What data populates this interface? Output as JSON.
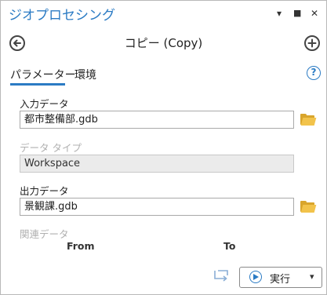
{
  "pane": {
    "title": "ジオプロセシング",
    "controls": {
      "dropdown": "▾",
      "maximize": "■",
      "close": "✕"
    }
  },
  "nav": {
    "back_icon": "back-arrow-icon",
    "tool_title": "コピー (Copy)",
    "add_icon": "add-icon"
  },
  "tabs": [
    {
      "label": "パラメーター",
      "active": true
    },
    {
      "label": "環境",
      "active": false
    }
  ],
  "help_symbol": "?",
  "params": {
    "input": {
      "label": "入力データ",
      "value": "都市整備部.gdb"
    },
    "data_type": {
      "label": "データ タイプ",
      "value": "Workspace"
    },
    "output": {
      "label": "出力データ",
      "value": "景観課.gdb"
    },
    "related": {
      "label": "関連データ",
      "col_from": "From",
      "col_to": "To"
    }
  },
  "footer": {
    "run_label": "実行",
    "run_dropdown": "▾"
  },
  "colors": {
    "accent": "#2b7bc4",
    "folder": "#f2c34b"
  }
}
